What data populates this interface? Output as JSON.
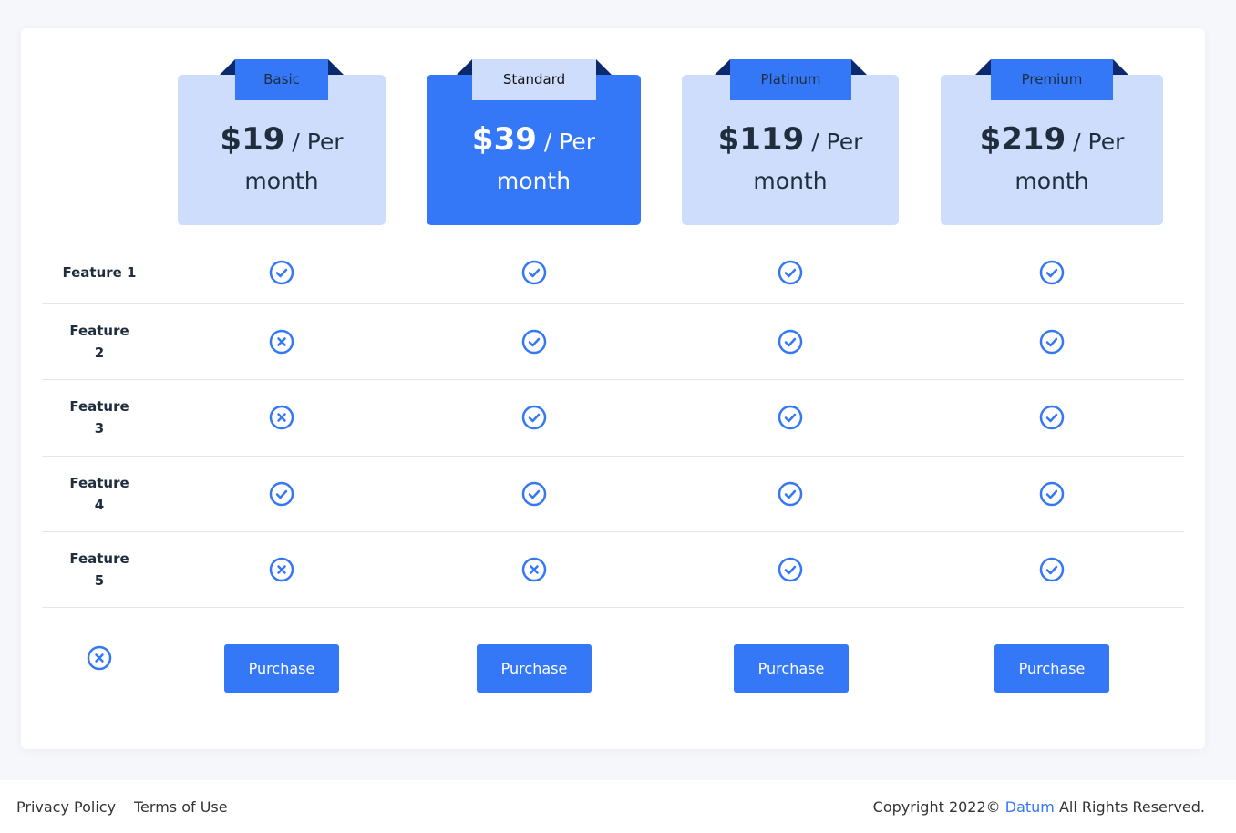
{
  "plans": [
    {
      "name": "Basic",
      "amount": "$19",
      "per": "/ Per",
      "period": "month"
    },
    {
      "name": "Standard",
      "amount": "$39",
      "per": "/ Per",
      "period": "month"
    },
    {
      "name": "Platinum",
      "amount": "$119",
      "per": "/ Per",
      "period": "month"
    },
    {
      "name": "Premium",
      "amount": "$219",
      "per": "/ Per",
      "period": "month"
    }
  ],
  "features": [
    {
      "word": "Feature 1",
      "num": "",
      "availability": [
        true,
        true,
        true,
        true
      ]
    },
    {
      "word": "Feature",
      "num": "2",
      "availability": [
        false,
        true,
        true,
        true
      ]
    },
    {
      "word": "Feature",
      "num": "3",
      "availability": [
        false,
        true,
        true,
        true
      ]
    },
    {
      "word": "Feature",
      "num": "4",
      "availability": [
        true,
        true,
        true,
        true
      ]
    },
    {
      "word": "Feature",
      "num": "5",
      "availability": [
        false,
        false,
        true,
        true
      ]
    }
  ],
  "purchase_label": "Purchase",
  "icons": {
    "included": "check-circle-icon",
    "excluded": "x-circle-icon"
  },
  "colors": {
    "accent": "#3477f7",
    "plan_bg": "#cfddfc",
    "ribbon_shadow": "#0b2a6e"
  },
  "footer": {
    "privacy": "Privacy Policy",
    "terms": "Terms of Use",
    "copyright_prefix": "Copyright 2022©",
    "brand": "Datum",
    "copyright_suffix": "All Rights Reserved."
  }
}
